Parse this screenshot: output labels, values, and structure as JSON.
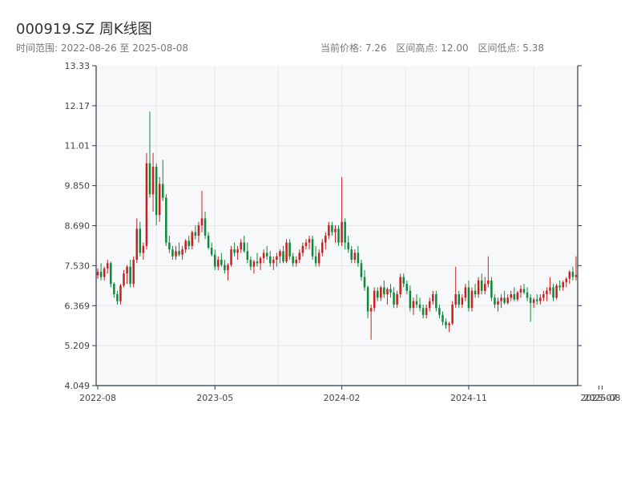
{
  "header": {
    "title": "000919.SZ 周K线图",
    "range_text": "时间范围: 2022-08-26 至 2025-08-08",
    "current_price_text": "当前价格: 7.26",
    "range_high_text": "区间高点: 12.00",
    "range_low_text": "区间低点: 5.38"
  },
  "colors": {
    "up": "#cc1f1f",
    "down": "#0f8a3a",
    "plot_bg": "#f7f8fa",
    "grid": "#e3e6ea",
    "axis": "#2b3a4a"
  },
  "chart_data": {
    "type": "candlestick",
    "title": "000919.SZ 周K线图",
    "xlabel": "",
    "ylabel": "",
    "ylim": [
      4.049,
      13.33
    ],
    "y_ticks": [
      "4.049",
      "5.209",
      "6.369",
      "7.530",
      "8.690",
      "9.850",
      "11.01",
      "12.17",
      "13.33"
    ],
    "x_ticks": [
      "2022-08",
      "2023-05",
      "2024-02",
      "2024-11",
      "2025-07",
      "2025-08"
    ],
    "x_tick_index": [
      0,
      36,
      75,
      114,
      154,
      155
    ],
    "grid": true,
    "series": [
      {
        "ohlc": [
          [
            7.25,
            7.45,
            7.15,
            7.35
          ],
          [
            7.35,
            7.6,
            7.1,
            7.2
          ],
          [
            7.2,
            7.5,
            7.1,
            7.45
          ],
          [
            7.45,
            7.7,
            7.3,
            7.6
          ],
          [
            7.6,
            7.65,
            6.9,
            7.0
          ],
          [
            7.0,
            7.05,
            6.6,
            6.7
          ],
          [
            6.7,
            6.8,
            6.4,
            6.5
          ],
          [
            6.5,
            7.0,
            6.4,
            6.95
          ],
          [
            6.95,
            7.4,
            6.9,
            7.3
          ],
          [
            7.3,
            7.55,
            7.0,
            7.5
          ],
          [
            7.5,
            7.7,
            6.9,
            7.0
          ],
          [
            7.0,
            7.8,
            6.9,
            7.7
          ],
          [
            7.7,
            8.9,
            7.6,
            8.6
          ],
          [
            8.6,
            8.8,
            7.8,
            7.9
          ],
          [
            7.9,
            8.2,
            7.7,
            8.1
          ],
          [
            8.1,
            10.8,
            8.0,
            10.5
          ],
          [
            10.5,
            12.0,
            9.5,
            9.6
          ],
          [
            9.6,
            10.8,
            9.1,
            10.4
          ],
          [
            10.4,
            10.5,
            8.7,
            9.0
          ],
          [
            9.0,
            10.1,
            8.8,
            9.9
          ],
          [
            9.9,
            10.6,
            9.4,
            9.5
          ],
          [
            9.5,
            9.6,
            8.1,
            8.2
          ],
          [
            8.2,
            8.4,
            7.9,
            8.0
          ],
          [
            8.0,
            8.1,
            7.7,
            7.8
          ],
          [
            7.8,
            8.1,
            7.7,
            7.95
          ],
          [
            7.95,
            8.2,
            7.8,
            7.85
          ],
          [
            7.85,
            8.1,
            7.7,
            8.0
          ],
          [
            8.0,
            8.3,
            7.9,
            8.25
          ],
          [
            8.25,
            8.4,
            8.0,
            8.1
          ],
          [
            8.1,
            8.55,
            8.0,
            8.5
          ],
          [
            8.5,
            8.7,
            8.3,
            8.4
          ],
          [
            8.4,
            8.8,
            8.2,
            8.7
          ],
          [
            8.7,
            9.7,
            8.5,
            8.9
          ],
          [
            8.9,
            9.1,
            8.3,
            8.4
          ],
          [
            8.4,
            8.5,
            8.0,
            8.05
          ],
          [
            8.05,
            8.2,
            7.8,
            7.85
          ],
          [
            7.85,
            8.0,
            7.4,
            7.5
          ],
          [
            7.5,
            7.8,
            7.4,
            7.7
          ],
          [
            7.7,
            7.9,
            7.5,
            7.55
          ],
          [
            7.55,
            7.7,
            7.3,
            7.4
          ],
          [
            7.4,
            7.6,
            7.1,
            7.55
          ],
          [
            7.55,
            8.1,
            7.5,
            8.0
          ],
          [
            8.0,
            8.2,
            7.8,
            7.9
          ],
          [
            7.9,
            8.1,
            7.7,
            8.0
          ],
          [
            8.0,
            8.3,
            7.9,
            8.2
          ],
          [
            8.2,
            8.4,
            7.9,
            7.95
          ],
          [
            7.95,
            8.2,
            7.6,
            7.7
          ],
          [
            7.7,
            7.8,
            7.4,
            7.5
          ],
          [
            7.5,
            7.7,
            7.3,
            7.65
          ],
          [
            7.65,
            7.9,
            7.5,
            7.6
          ],
          [
            7.6,
            7.8,
            7.4,
            7.75
          ],
          [
            7.75,
            8.0,
            7.6,
            7.9
          ],
          [
            7.9,
            8.1,
            7.7,
            7.8
          ],
          [
            7.8,
            7.95,
            7.5,
            7.6
          ],
          [
            7.6,
            7.8,
            7.4,
            7.7
          ],
          [
            7.7,
            7.9,
            7.5,
            7.8
          ],
          [
            7.8,
            8.0,
            7.6,
            7.95
          ],
          [
            7.95,
            8.1,
            7.6,
            7.65
          ],
          [
            7.65,
            8.3,
            7.6,
            8.2
          ],
          [
            8.2,
            8.3,
            7.7,
            7.8
          ],
          [
            7.8,
            7.9,
            7.5,
            7.6
          ],
          [
            7.6,
            7.8,
            7.5,
            7.7
          ],
          [
            7.7,
            8.0,
            7.6,
            7.9
          ],
          [
            7.9,
            8.2,
            7.8,
            8.1
          ],
          [
            8.1,
            8.3,
            8.0,
            8.2
          ],
          [
            8.2,
            8.4,
            8.0,
            8.3
          ],
          [
            8.3,
            8.4,
            7.7,
            7.8
          ],
          [
            7.8,
            8.1,
            7.5,
            7.6
          ],
          [
            7.6,
            8.0,
            7.5,
            7.9
          ],
          [
            7.9,
            8.3,
            7.8,
            8.2
          ],
          [
            8.2,
            8.5,
            8.0,
            8.4
          ],
          [
            8.4,
            8.8,
            8.3,
            8.7
          ],
          [
            8.7,
            8.8,
            8.4,
            8.5
          ],
          [
            8.5,
            8.7,
            8.2,
            8.6
          ],
          [
            8.6,
            8.7,
            8.1,
            8.2
          ],
          [
            8.2,
            10.1,
            8.1,
            8.8
          ],
          [
            8.8,
            8.9,
            8.0,
            8.2
          ],
          [
            8.2,
            8.4,
            7.9,
            8.0
          ],
          [
            8.0,
            8.1,
            7.6,
            7.7
          ],
          [
            7.7,
            8.0,
            7.6,
            7.9
          ],
          [
            7.9,
            8.1,
            7.5,
            7.6
          ],
          [
            7.6,
            7.7,
            7.1,
            7.2
          ],
          [
            7.2,
            7.4,
            6.8,
            6.9
          ],
          [
            6.9,
            6.95,
            6.0,
            6.2
          ],
          [
            6.2,
            6.4,
            5.38,
            6.3
          ],
          [
            6.3,
            6.9,
            6.2,
            6.8
          ],
          [
            6.8,
            6.9,
            6.5,
            6.6
          ],
          [
            6.6,
            6.95,
            6.5,
            6.9
          ],
          [
            6.9,
            7.1,
            6.6,
            6.7
          ],
          [
            6.7,
            6.9,
            6.4,
            6.85
          ],
          [
            6.85,
            7.0,
            6.6,
            6.75
          ],
          [
            6.75,
            6.9,
            6.3,
            6.4
          ],
          [
            6.4,
            6.8,
            6.3,
            6.7
          ],
          [
            6.7,
            7.3,
            6.6,
            7.2
          ],
          [
            7.2,
            7.3,
            6.9,
            7.0
          ],
          [
            7.0,
            7.1,
            6.7,
            6.8
          ],
          [
            6.8,
            6.95,
            6.2,
            6.3
          ],
          [
            6.3,
            6.6,
            6.1,
            6.5
          ],
          [
            6.5,
            6.7,
            6.3,
            6.4
          ],
          [
            6.4,
            6.6,
            6.2,
            6.3
          ],
          [
            6.3,
            6.4,
            6.0,
            6.1
          ],
          [
            6.1,
            6.4,
            6.0,
            6.3
          ],
          [
            6.3,
            6.6,
            6.2,
            6.5
          ],
          [
            6.5,
            6.8,
            6.4,
            6.7
          ],
          [
            6.7,
            6.8,
            6.2,
            6.3
          ],
          [
            6.3,
            6.4,
            6.0,
            6.1
          ],
          [
            6.1,
            6.2,
            5.8,
            5.9
          ],
          [
            5.9,
            6.0,
            5.7,
            5.8
          ],
          [
            5.8,
            5.9,
            5.6,
            5.85
          ],
          [
            5.85,
            6.5,
            5.8,
            6.4
          ],
          [
            6.4,
            7.5,
            6.3,
            6.7
          ],
          [
            6.7,
            6.8,
            6.3,
            6.4
          ],
          [
            6.4,
            6.7,
            6.3,
            6.6
          ],
          [
            6.6,
            7.0,
            6.5,
            6.9
          ],
          [
            6.9,
            7.1,
            6.2,
            6.3
          ],
          [
            6.3,
            6.9,
            6.2,
            6.8
          ],
          [
            6.8,
            7.0,
            6.6,
            6.7
          ],
          [
            6.7,
            7.2,
            6.6,
            7.1
          ],
          [
            7.1,
            7.3,
            6.7,
            6.8
          ],
          [
            6.8,
            7.2,
            6.7,
            7.0
          ],
          [
            7.0,
            7.8,
            6.9,
            7.1
          ],
          [
            7.1,
            7.2,
            6.5,
            6.6
          ],
          [
            6.6,
            6.7,
            6.3,
            6.4
          ],
          [
            6.4,
            6.6,
            6.2,
            6.5
          ],
          [
            6.5,
            6.7,
            6.3,
            6.6
          ],
          [
            6.6,
            6.8,
            6.4,
            6.45
          ],
          [
            6.45,
            6.7,
            6.4,
            6.6
          ],
          [
            6.6,
            6.8,
            6.5,
            6.7
          ],
          [
            6.7,
            6.9,
            6.5,
            6.55
          ],
          [
            6.55,
            6.8,
            6.5,
            6.75
          ],
          [
            6.75,
            6.95,
            6.6,
            6.85
          ],
          [
            6.85,
            7.0,
            6.7,
            6.75
          ],
          [
            6.75,
            6.9,
            6.5,
            6.6
          ],
          [
            6.6,
            6.7,
            5.9,
            6.45
          ],
          [
            6.45,
            6.6,
            6.3,
            6.55
          ],
          [
            6.55,
            6.7,
            6.4,
            6.5
          ],
          [
            6.5,
            6.7,
            6.4,
            6.6
          ],
          [
            6.6,
            6.8,
            6.5,
            6.7
          ],
          [
            6.7,
            6.9,
            6.5,
            6.8
          ],
          [
            6.8,
            7.2,
            6.7,
            6.9
          ],
          [
            6.9,
            7.0,
            6.5,
            6.6
          ],
          [
            6.6,
            7.0,
            6.55,
            6.95
          ],
          [
            6.95,
            7.1,
            6.8,
            6.9
          ],
          [
            6.9,
            7.1,
            6.8,
            7.05
          ],
          [
            7.05,
            7.2,
            6.9,
            7.15
          ],
          [
            7.15,
            7.4,
            7.0,
            7.35
          ],
          [
            7.35,
            7.5,
            7.1,
            7.2
          ],
          [
            7.2,
            7.8,
            7.1,
            7.26
          ]
        ]
      }
    ]
  }
}
